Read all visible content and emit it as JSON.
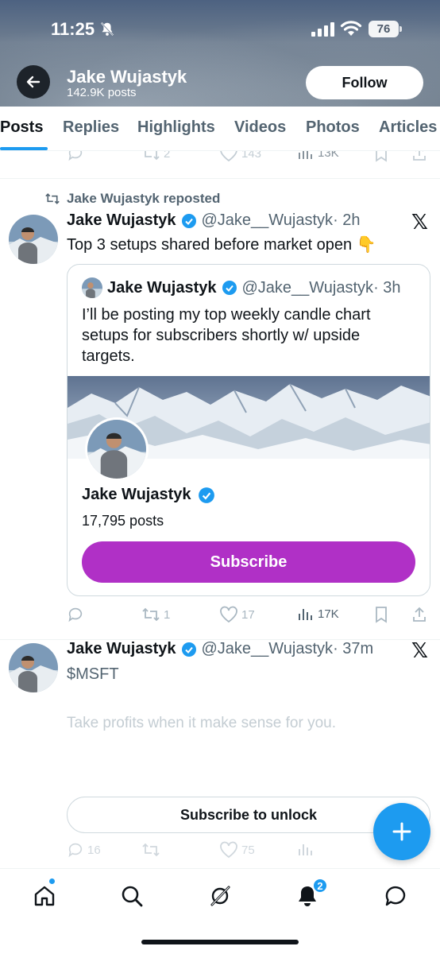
{
  "status_bar": {
    "time": "11:25",
    "battery": "76"
  },
  "profile": {
    "name": "Jake Wujastyk",
    "posts_count": "142.9K posts",
    "follow_label": "Follow"
  },
  "tabs": [
    "Posts",
    "Replies",
    "Highlights",
    "Videos",
    "Photos",
    "Articles"
  ],
  "active_tab": "Posts",
  "top_actions": {
    "retweets": "2",
    "likes": "143",
    "views": "13K"
  },
  "tweet1": {
    "repost_label": "Jake Wujastyk reposted",
    "author": "Jake Wujastyk",
    "handle": "@Jake__Wujastyk",
    "time": "· 2h",
    "text": "Top 3 setups shared before market open 👇",
    "quote": {
      "author": "Jake Wujastyk",
      "handle": "@Jake__Wujastyk",
      "time": "· 3h",
      "text": "I’ll be posting my top weekly candle chart setups for subscribers shortly w/ upside targets.",
      "card": {
        "name": "Jake Wujastyk",
        "posts": "17,795 posts",
        "button": "Subscribe"
      }
    },
    "actions": {
      "retweets": "1",
      "likes": "17",
      "views": "17K"
    }
  },
  "tweet2": {
    "author": "Jake Wujastyk",
    "handle": "@Jake__Wujastyk",
    "time": "· 37m",
    "text": "$MSFT",
    "locked_text": "Take profits when it make sense for you.",
    "unlock_label": "Subscribe to unlock",
    "actions": {
      "replies": "16",
      "likes": "75"
    }
  },
  "nav": {
    "notifications_badge": "2"
  },
  "colors": {
    "accent": "#1d9bf0",
    "subscribe": "#b030c6",
    "verified": "#1d9bf0"
  }
}
